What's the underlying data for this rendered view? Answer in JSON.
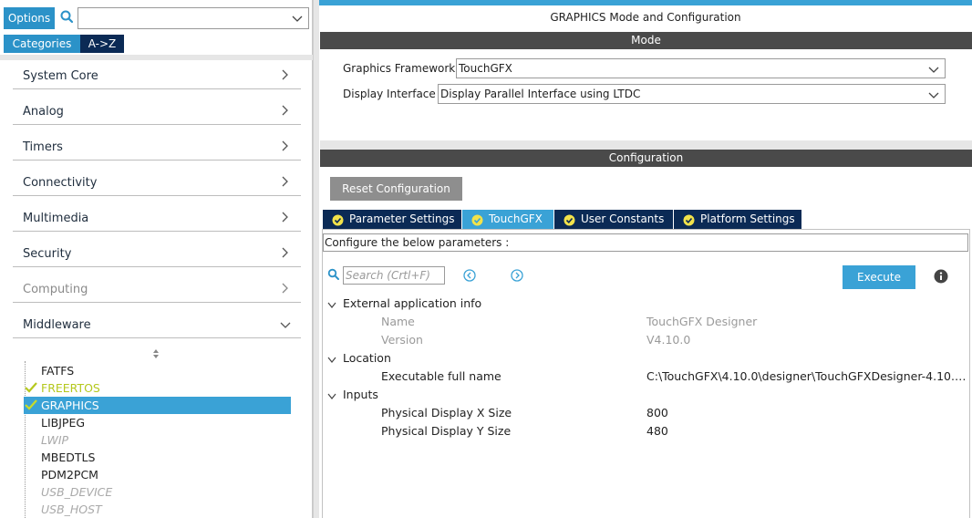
{
  "left": {
    "options_label": "Options",
    "search_value": "",
    "categories_tab": "Categories",
    "atoz_tab": "A->Z",
    "categories": [
      {
        "label": "System Core",
        "enabled": true,
        "expanded": false
      },
      {
        "label": "Analog",
        "enabled": true,
        "expanded": false
      },
      {
        "label": "Timers",
        "enabled": true,
        "expanded": false
      },
      {
        "label": "Connectivity",
        "enabled": true,
        "expanded": false
      },
      {
        "label": "Multimedia",
        "enabled": true,
        "expanded": false
      },
      {
        "label": "Security",
        "enabled": true,
        "expanded": false
      },
      {
        "label": "Computing",
        "enabled": false,
        "expanded": false
      },
      {
        "label": "Middleware",
        "enabled": true,
        "expanded": true
      }
    ],
    "middleware_items": [
      {
        "label": "FATFS",
        "state": "normal"
      },
      {
        "label": "FREERTOS",
        "state": "checked"
      },
      {
        "label": "GRAPHICS",
        "state": "selected-checked"
      },
      {
        "label": "LIBJPEG",
        "state": "normal"
      },
      {
        "label": "LWIP",
        "state": "disabled"
      },
      {
        "label": "MBEDTLS",
        "state": "normal"
      },
      {
        "label": "PDM2PCM",
        "state": "normal"
      },
      {
        "label": "USB_DEVICE",
        "state": "disabled"
      },
      {
        "label": "USB_HOST",
        "state": "disabled"
      }
    ]
  },
  "right": {
    "title": "GRAPHICS Mode and Configuration",
    "mode_header": "Mode",
    "graphics_framework_label": "Graphics Framework",
    "graphics_framework_value": "TouchGFX",
    "display_interface_label": "Display Interface",
    "display_interface_value": "Display Parallel Interface using LTDC",
    "config_header": "Configuration",
    "reset_label": "Reset Configuration",
    "tabs": [
      {
        "label": "Parameter Settings",
        "active": false
      },
      {
        "label": "TouchGFX",
        "active": true
      },
      {
        "label": "User Constants",
        "active": false
      },
      {
        "label": "Platform Settings",
        "active": false
      }
    ],
    "configure_text": "Configure the below parameters :",
    "search_placeholder": "Search (Crtl+F)",
    "execute_label": "Execute",
    "groups": [
      {
        "label": "External application info",
        "params": [
          {
            "name": "Name",
            "value": "TouchGFX Designer",
            "dim": true
          },
          {
            "name": "Version",
            "value": "V4.10.0",
            "dim": true
          }
        ]
      },
      {
        "label": "Location",
        "params": [
          {
            "name": "Executable full name",
            "value": "C:\\TouchGFX\\4.10.0\\designer\\TouchGFXDesigner-4.10.0.e…",
            "dim": false
          }
        ]
      },
      {
        "label": "Inputs",
        "params": [
          {
            "name": "Physical Display X Size",
            "value": "800",
            "dim": false
          },
          {
            "name": "Physical Display Y Size",
            "value": "480",
            "dim": false
          }
        ]
      }
    ]
  },
  "colors": {
    "accent_blue": "#3aa2d6",
    "dark_navy": "#0b2a55",
    "header_gray": "#4a4a4a",
    "check_green": "#b5c81e"
  }
}
